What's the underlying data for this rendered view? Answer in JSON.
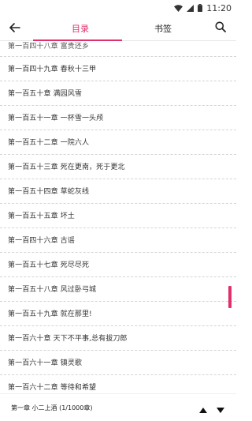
{
  "status_bar": {
    "time": "11:20",
    "wifi_icon": "wifi-icon",
    "signal_icon": "signal-icon",
    "battery_icon": "battery-icon"
  },
  "nav": {
    "back_icon": "arrow-left-icon",
    "tabs": [
      {
        "label": "目录",
        "selected": true
      },
      {
        "label": "书签",
        "selected": false
      }
    ],
    "search_icon": "search-icon",
    "accent_color": "#e0306a"
  },
  "chapters": [
    "第一百四十八章 富贵还乡",
    "第一百四十九章 春秋十三甲",
    "第一百五十章 满园风雪",
    "第一百五十一章 一杯雪一头颅",
    "第一百五十二章 一院六人",
    "第一百五十三章 死在更南，死于更北",
    "第一百五十四章 草蛇灰线",
    "第一百五十五章 坏土",
    "第一百四十六章 古谣",
    "第一百五十七章 死尽尽死",
    "第一百五十八章 风过卧弓城",
    "第一百五十九章 就在那里!",
    "第一百六十章 天下不平事,总有拔刀郎",
    "第一百六十一章 镇灵歌",
    "第一百六十二章 等待和希望"
  ],
  "footer": {
    "current_chapter": "第一章 小二上酒 (1/1000章)",
    "up_icon": "triangle-up-icon",
    "down_icon": "triangle-down-icon"
  }
}
